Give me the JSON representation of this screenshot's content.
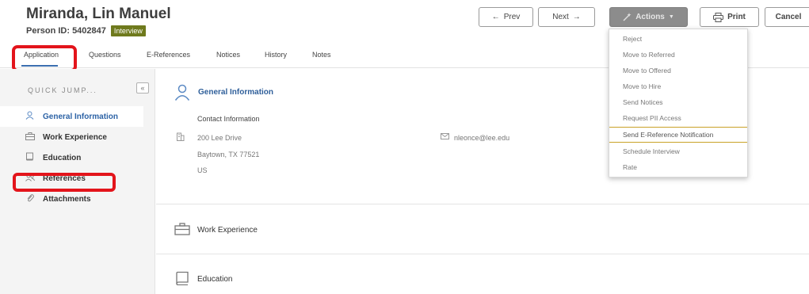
{
  "candidate": {
    "name": "Miranda, Lin Manuel",
    "person_id": "Person ID: 5402847",
    "status_badge": "Interview"
  },
  "toolbar": {
    "prev_label": "Prev",
    "next_label": "Next",
    "actions_label": "Actions",
    "print_label": "Print",
    "cancel_label": "Cancel",
    "prev_arrow": "←",
    "next_arrow": "→"
  },
  "tabs": [
    {
      "label": "Application",
      "active": true
    },
    {
      "label": "Questions"
    },
    {
      "label": "E-References"
    },
    {
      "label": "Notices"
    },
    {
      "label": "History"
    },
    {
      "label": "Notes"
    }
  ],
  "sidebar": {
    "heading": "QUICK JUMP...",
    "collapse_glyph": "«",
    "items": [
      {
        "label": "General Information",
        "icon": "person-icon",
        "active": true
      },
      {
        "label": "Work Experience",
        "icon": "briefcase-icon"
      },
      {
        "label": "Education",
        "icon": "book-icon"
      },
      {
        "label": "References",
        "icon": "people-icon"
      },
      {
        "label": "Attachments",
        "icon": "paperclip-icon"
      }
    ]
  },
  "general_info": {
    "title": "General Information",
    "contact_label": "Contact Information",
    "address_line1": "200 Lee Drive",
    "address_line2": "Baytown, TX 77521",
    "address_line3": "US",
    "email": "nleonce@lee.edu"
  },
  "sections": {
    "work_experience": "Work Experience",
    "education": "Education"
  },
  "actions_menu": [
    {
      "label": "Reject"
    },
    {
      "label": "Move to Referred"
    },
    {
      "label": "Move to Offered"
    },
    {
      "label": "Move to Hire"
    },
    {
      "label": "Send Notices"
    },
    {
      "label": "Request PII Access"
    },
    {
      "label": "Send E-Reference Notification",
      "highlighted": true
    },
    {
      "label": "Schedule Interview"
    },
    {
      "label": "Rate"
    }
  ],
  "colors": {
    "accent_blue": "#2d63a6",
    "badge_olive": "#6f7a1d",
    "highlight_red": "#e3141b",
    "menu_highlight": "#c9a227"
  }
}
